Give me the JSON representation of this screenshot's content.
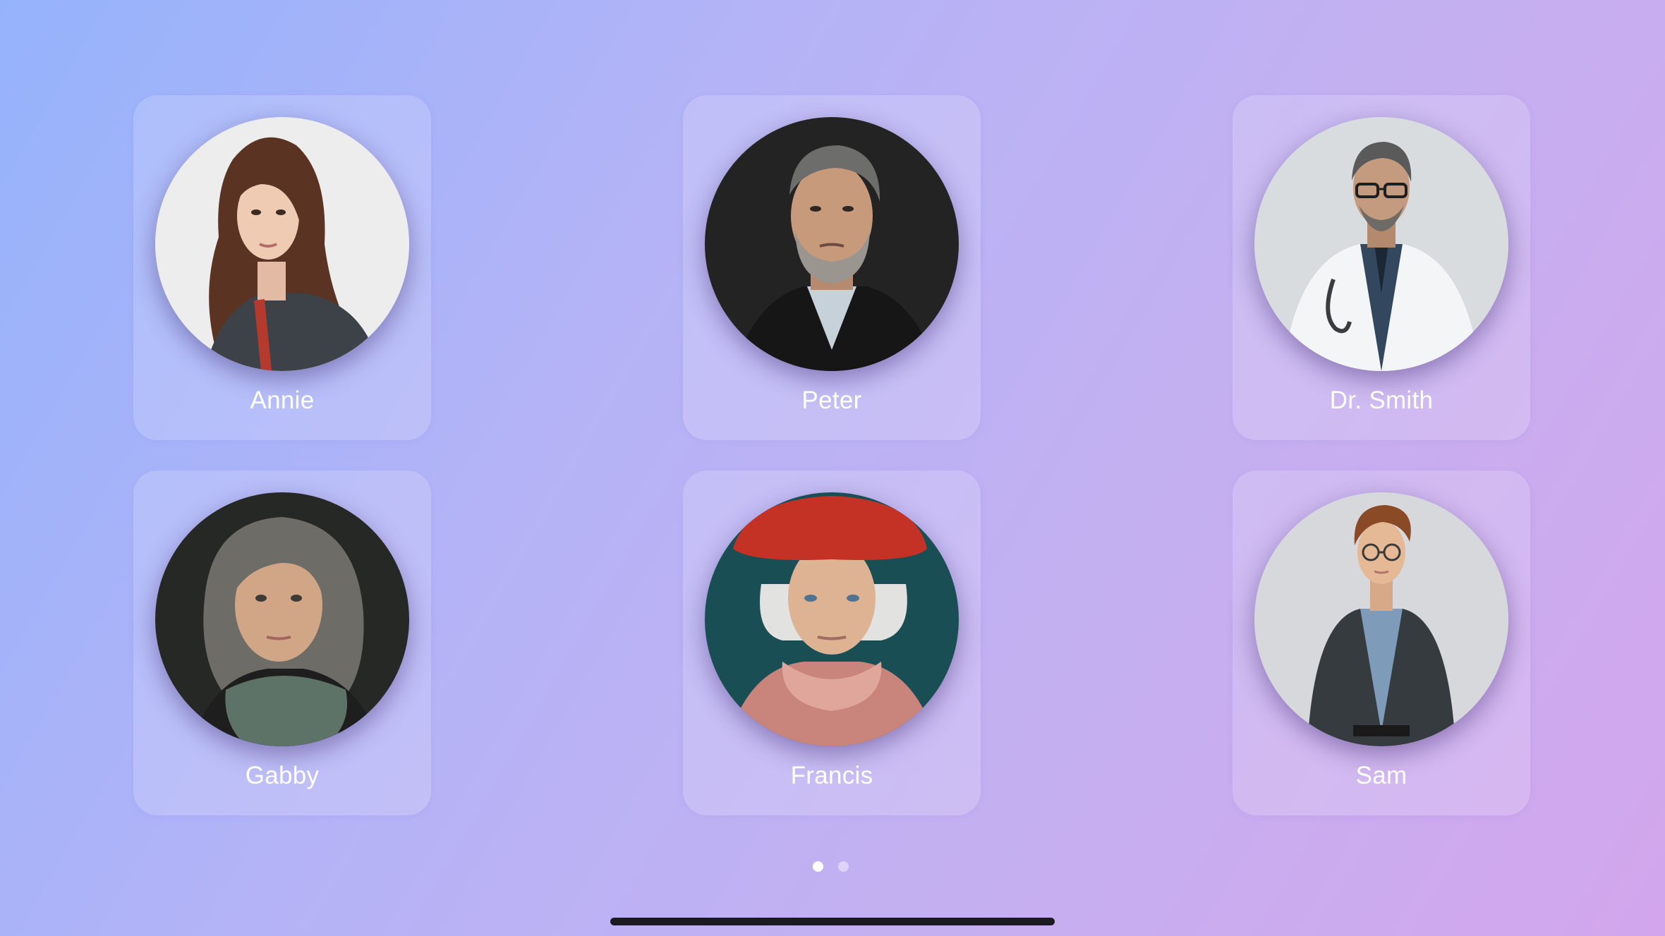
{
  "personas": [
    {
      "name": "Annie"
    },
    {
      "name": "Peter"
    },
    {
      "name": "Dr. Smith"
    },
    {
      "name": "Gabby"
    },
    {
      "name": "Francis"
    },
    {
      "name": "Sam"
    }
  ],
  "pagination": {
    "pages": 2,
    "current": 1
  },
  "colors": {
    "gradient_start": "#95b3fb",
    "gradient_end": "#d3a6ec",
    "card": "rgba(255,255,255,0.17)",
    "label": "#ffffff"
  }
}
